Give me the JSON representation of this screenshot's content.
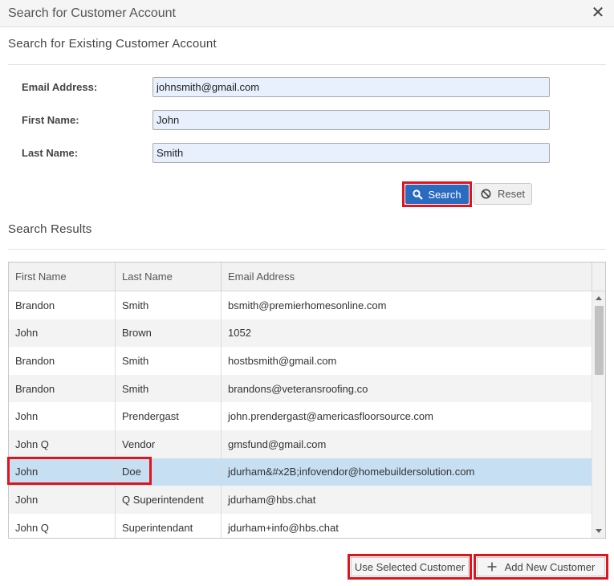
{
  "dialog": {
    "title": "Search for Customer Account",
    "close_glyph": "✕"
  },
  "search_section": {
    "title": "Search for Existing Customer Account",
    "fields": {
      "email": {
        "label": "Email Address:",
        "value": "johnsmith@gmail.com"
      },
      "first_name": {
        "label": "First Name:",
        "value": "John"
      },
      "last_name": {
        "label": "Last Name:",
        "value": "Smith"
      }
    },
    "search_label": "Search",
    "reset_label": "Reset"
  },
  "results_section": {
    "title": "Search Results",
    "columns": [
      "First Name",
      "Last Name",
      "Email Address"
    ],
    "rows": [
      {
        "first": "Brandon",
        "last": "Smith",
        "email": "bsmith@premierhomesonline.com"
      },
      {
        "first": "John",
        "last": "Brown",
        "email": "1052"
      },
      {
        "first": "Brandon",
        "last": "Smith",
        "email": "hostbsmith@gmail.com"
      },
      {
        "first": "Brandon",
        "last": "Smith",
        "email": "brandons@veteransroofing.co"
      },
      {
        "first": "John",
        "last": "Prendergast",
        "email": "john.prendergast@americasfloorsource.com"
      },
      {
        "first": "John Q",
        "last": "Vendor",
        "email": "gmsfund@gmail.com"
      },
      {
        "first": "John",
        "last": "Doe",
        "email": "jdurham&#x2B;infovendor@homebuildersolution.com",
        "selected": true
      },
      {
        "first": "John",
        "last": "Q Superintendent",
        "email": "jdurham@hbs.chat"
      },
      {
        "first": "John Q",
        "last": "Superintendant",
        "email": "jdurham+info@hbs.chat"
      }
    ]
  },
  "footer": {
    "use_selected_label": "Use Selected Customer",
    "add_new_label": "Add New Customer"
  },
  "colors": {
    "primary": "#2a6bbf",
    "highlight_outline": "#e0141e",
    "selected_row": "#c6dff2"
  },
  "icons": {
    "search": "search-icon",
    "reset": "ban-icon",
    "add": "plus-icon",
    "close": "close-icon"
  }
}
